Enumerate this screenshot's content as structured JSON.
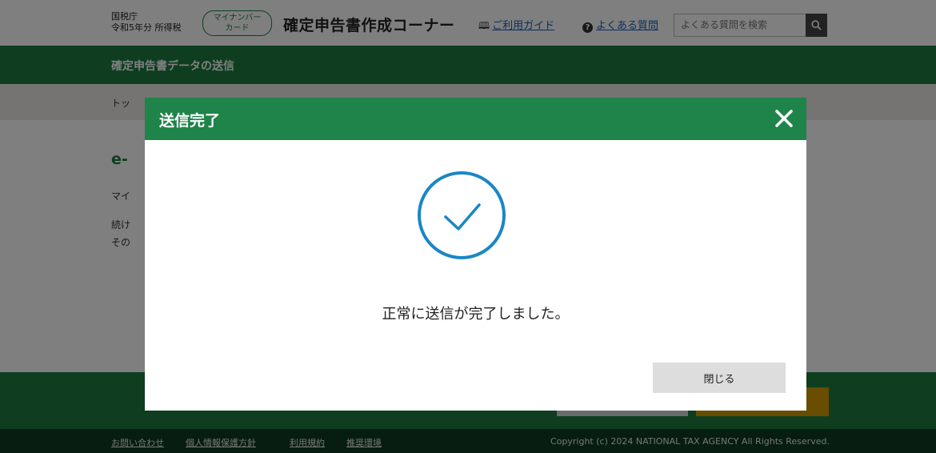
{
  "header": {
    "agency_name": "国税庁",
    "year_type": "令和5年分 所得税",
    "mynumber_badge_line1": "マイナンバー",
    "mynumber_badge_line2": "カード",
    "site_title": "確定申告書作成コーナー",
    "guide_link": "ご利用ガイド",
    "faq_link": "よくある質問",
    "search_placeholder": "よくある質問を検索"
  },
  "page": {
    "title": "確定申告書データの送信",
    "breadcrumb": "トッ",
    "heading_fragment": "e-",
    "para1_fragment": "マイ",
    "para2_fragment": "続け",
    "para3_fragment": "その"
  },
  "footer": {
    "links": [
      "お問い合わせ",
      "個人情報保護方針",
      "利用規約",
      "推奨環境"
    ],
    "copyright": "Copyright (c) 2024 NATIONAL TAX AGENCY All Rights Reserved."
  },
  "modal": {
    "title": "送信完了",
    "message": "正常に送信が完了しました。",
    "close_button": "閉じる",
    "icons": {
      "close": "close-icon",
      "success": "check-circle-icon"
    }
  },
  "colors": {
    "brand_green": "#1c7c3e",
    "modal_header": "#1e8449",
    "check_blue": "#1a86c7",
    "footer_dark": "#0f3a22",
    "accent_gold": "#d29a00"
  }
}
